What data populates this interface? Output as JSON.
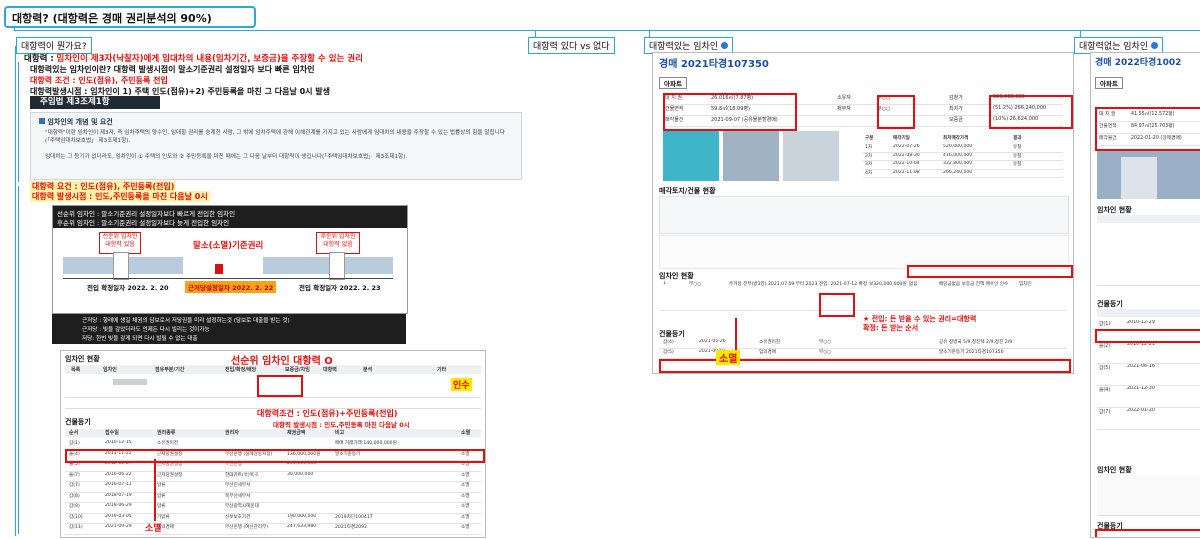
{
  "root": {
    "title": "대항력? (대항력은 경매 권리분석의 90%)"
  },
  "branches": {
    "b1": "대항력이 뭔가요?",
    "b2": "대항력 있다 vs 없다",
    "b3": "대항력있는 임차인",
    "b4": "대항력없는 임차인"
  },
  "b1": {
    "def_label": "대항력 :",
    "def_text": "임차인이 제3자(낙찰자)에게 임대차의 내용(임차기간, 보증금)을 주장할 수 있는 권리",
    "item1": "대항력있는 임차인이란? 대항력 발생시점이 말소기준권리 설정일자 보다 빠른 임차인",
    "item2": "대항력 조건 : 인도(점유), 주민등록 전입",
    "item3": "대항력발생시점 : 임차인이 1) 주택 인도(점유)+2) 주민등록을 마친 그 다음날 0시 발생",
    "law_label": "주임법 제3조제1항",
    "law_heading": "임차인의 개념 및 요건",
    "law_p1": "\"대항력\"이란 임차인이 제3자, 즉 임차주택의 양수인, 임대할 권리를 승계한 사람, 그 밖에 임차주택에 관해 이해관계를 가지고 있는 사람에게 임대차의 내용을 주장할 수 있는 법률상의 힘을 말합니다(「주택임대차보호법」 제3조제1항).",
    "law_p2": "임대차는 그 등기가 없더라도, 임차인이 ① 주택의 인도와 ② 주민등록을 마친 때에는 그 다음 날부터 대항력이 생깁니다(「주택임대차보호법」 제3조제1항).",
    "hl1": "대항력 요건 : 인도(점유), 주민등록(전입)",
    "hl2": "대항력 발생시점 : 인도,주민등록을 마친 다음날 0시",
    "timeline": {
      "line1": "선순위 임차인 : 말소기준권리 설정일자보다 빠르게 전입한 임차인",
      "line2": "후순위 임차인 : 말소기준권리 설정일자보다 늦게 전입한 임차인",
      "senior_box": "선순위 임차인\n대항력 있음",
      "junior_box": "후순위 임차인\n대항력 없음",
      "center": "말소(소멸)기준권리",
      "date_left": "전입 확정일자 2022. 2. 20",
      "date_center": "근저당설정일자 2022. 2. 22",
      "date_right": "전입 확정일자 2022. 2. 23",
      "note1": "근저당 : 향래에 생길 채권의 담보로서 저당권을 미리 설정하는것 (담보로 대출을 받는 것)",
      "note2": "근저당 : 빚을 갚았더라도 언제든 다시 빌리는 것이가능",
      "note3": "저당: 한번 빚을 갚게 되면 다시 빌릴 수 없는 대출"
    },
    "doc": {
      "title": "선순위 임차인 대항력 O",
      "tenant_section": "임차인 현황",
      "takeover": "인수",
      "condition": "대항력조건 : 인도(점유)+주민등록(전입)",
      "timing": "대항력 발생시점 : 인도,주민등록 마친 다음날 0시",
      "registry_section": "건물등기",
      "extinct": "소멸",
      "headers": [
        "목록",
        "임차인",
        "점유부분/기간",
        "전입/확정/배당",
        "보증금/차임",
        "대항력",
        "분석",
        "기타"
      ],
      "reg_headers": [
        "순서",
        "접수일",
        "권리종류",
        "권리자",
        "채권금액",
        "비고",
        "소멸"
      ],
      "reg_rows": [
        [
          "갑(1)",
          "2010-12-15",
          "소유권이전",
          "",
          "",
          "매매 거래가액:140,000,000원",
          ""
        ],
        [
          "을(4)",
          "2011-11-22",
          "근저당권설정",
          "부산은행 (실례강동지점)",
          "136,000,000원",
          "말소기준등기",
          "소멸"
        ],
        [
          "을(5)",
          "2012-06-27",
          "근저당권설정",
          "부산은행",
          "204,000,000",
          "",
          "소멸"
        ],
        [
          "을(7)",
          "2016-06-22",
          "근저당권설정",
          "한대카트(유)북구",
          "30,000,000",
          "",
          "소멸"
        ],
        [
          "갑(7)",
          "2016-07-11",
          "압류",
          "부산진세무서",
          "",
          "",
          "소멸"
        ],
        [
          "갑(8)",
          "2018-07-19",
          "압류",
          "북부산세무서",
          "",
          "",
          "소멸"
        ],
        [
          "갑(9)",
          "2018-06-29",
          "압류",
          "부산광역시해운대",
          "",
          "",
          "소멸"
        ],
        [
          "갑(10)",
          "2019-03-05",
          "가압류",
          "신보보호기관",
          "190,000,000",
          "2019카단100417",
          "소멸"
        ],
        [
          "갑(11)",
          "2021-09-29",
          "임의경매",
          "부산은행 (여신관리부)",
          "247,633,980",
          "2021타경2093",
          "소멸"
        ]
      ]
    }
  },
  "b3": {
    "case": "경매 2021타경107350",
    "type_badge": "아파트",
    "summary_rows": [
      [
        "대 지 권",
        "26.016㎡(7.87평)",
        "소유자",
        "부○○",
        "감정가",
        "520,000,000"
      ],
      [
        "건물면적",
        "59.8㎡(18.09평)",
        "채무자",
        "부○○",
        "최저가",
        "(51.2%) 266,240,000"
      ],
      [
        "매각물건",
        "2021-09-07 (공유물분할경매)",
        "",
        "",
        "보증금",
        "(10%) 26,624,000"
      ]
    ],
    "history_head": [
      "구분",
      "매각기일",
      "최저매각가격",
      "결과"
    ],
    "history_rows": [
      [
        "1차",
        "2022-07-26",
        "520,000,000",
        "유찰"
      ],
      [
        "2차",
        "2022-08-30",
        "416,000,000",
        "유찰"
      ],
      [
        "3차",
        "2022-10-04",
        "332,800,000",
        "유찰"
      ],
      [
        "4차",
        "2022-11-08",
        "266,240,000",
        ""
      ]
    ],
    "land_section": "매각토지/건물 현황",
    "tenant_section": "임차인 현황",
    "tenant_row": [
      "1",
      "부○○",
      "주거용 전부(방3칸) 2021.07.09.부터 2023.07.09.까지",
      "전입: 2021-07-12 확정: 2021-05-31 배당: 없음",
      "보320,000,000원",
      "없음",
      "배당금없음 보증금 전액 매수인 인수",
      "임차인"
    ],
    "annot": "★ 전입: 돈 받을 수 있는 권리=대항력\n확정: 돈 받는 순서",
    "registry_section": "건물등기",
    "reg_rows": [
      [
        "갑(4)",
        "2021-05-26",
        "소유권이전",
        "부○○",
        "",
        "",
        "공유 정병국 5/9,정진택 2/9,정진 2/9"
      ],
      [
        "갑(5)",
        "2021-09-07",
        "임의경매",
        "부○○",
        "",
        "",
        "말소기준등기 2021타경107350"
      ]
    ],
    "extinct": "소멸"
  },
  "b4": {
    "case": "경매 2022타경1002",
    "type_badge": "아파트",
    "summary_rows": [
      [
        "대 지 권",
        "41.55㎡(12.572평)"
      ],
      [
        "건물면적",
        "84.97㎡(25.703평)"
      ],
      [
        "매각물건",
        "2022-01-20 (강제경매)"
      ]
    ],
    "tenant_section": "임차인 현황",
    "tenant_section2": "임차인 현황",
    "registry_section": "건물등기",
    "registry_section2": "건물등기",
    "reg_rows": [
      [
        "갑(1)",
        "2010-12-29"
      ],
      [
        "을(2)",
        "2010-12-21"
      ],
      [
        "갑(5)",
        "2021-06-16"
      ],
      [
        "을(4)",
        "2021-12-30"
      ],
      [
        "갑(7)",
        "2022-01-20"
      ]
    ]
  }
}
